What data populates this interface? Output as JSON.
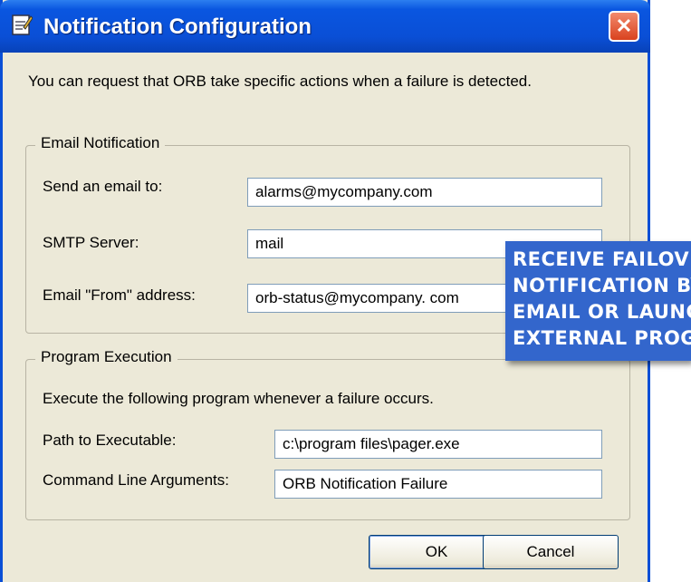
{
  "window": {
    "title": "Notification Configuration",
    "close_glyph": "✕",
    "icons": {
      "app": "notepad-icon",
      "close": "close-icon"
    }
  },
  "intro_text": "You can request that ORB take specific actions when a failure is detected.",
  "email_group": {
    "legend": "Email Notification",
    "send_to_label": "Send an email to:",
    "send_to_value": "alarms@mycompany.com",
    "smtp_label": "SMTP Server:",
    "smtp_value": "mail",
    "from_label": "Email \"From\" address:",
    "from_value": "orb-status@mycompany. com"
  },
  "program_group": {
    "legend": "Program Execution",
    "description": "Execute the following program whenever a failure occurs.",
    "path_label": "Path to Executable:",
    "path_value": "c:\\program files\\pager.exe",
    "args_label": "Command Line Arguments:",
    "args_value": "ORB Notification Failure"
  },
  "buttons": {
    "ok": "OK",
    "cancel": "Cancel"
  },
  "callout": {
    "lines": [
      "RECEIVE FAILOVER",
      "NOTIFICATION BY",
      "EMAIL OR LAUNCH",
      "EXTERNAL PROGRAM"
    ]
  },
  "colors": {
    "titlebar": "#0a4fd6",
    "window_bg": "#ece9d8",
    "close_button": "#d9421e",
    "callout_bg": "#3366cc"
  }
}
